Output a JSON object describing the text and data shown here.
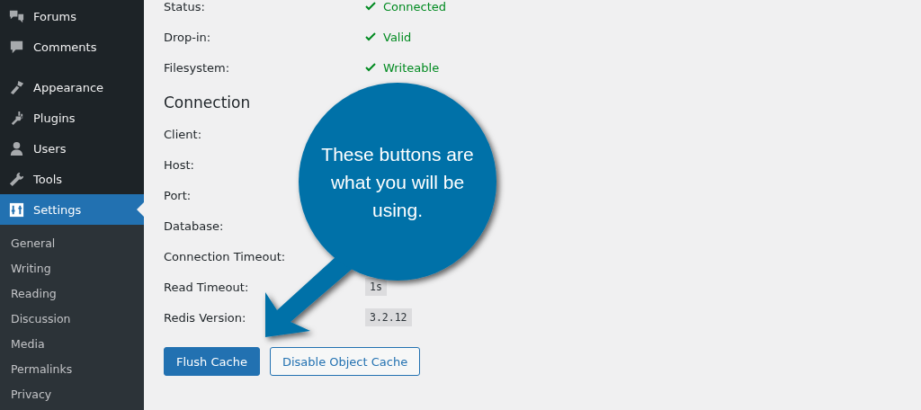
{
  "sidebar": {
    "items": [
      {
        "label": "Forums",
        "selected": false
      },
      {
        "label": "Comments",
        "selected": false
      },
      {
        "label": "Appearance",
        "selected": false
      },
      {
        "label": "Plugins",
        "selected": false
      },
      {
        "label": "Users",
        "selected": false
      },
      {
        "label": "Tools",
        "selected": false
      },
      {
        "label": "Settings",
        "selected": true
      }
    ],
    "submenu": [
      {
        "label": "General"
      },
      {
        "label": "Writing"
      },
      {
        "label": "Reading"
      },
      {
        "label": "Discussion"
      },
      {
        "label": "Media"
      },
      {
        "label": "Permalinks"
      },
      {
        "label": "Privacy"
      }
    ]
  },
  "status_rows": [
    {
      "label": "Status:",
      "kind": "status",
      "value": "Connected"
    },
    {
      "label": "Drop-in:",
      "kind": "status",
      "value": "Valid"
    },
    {
      "label": "Filesystem:",
      "kind": "status",
      "value": "Writeable"
    }
  ],
  "connection": {
    "heading": "Connection",
    "rows": [
      {
        "label": "Client:"
      },
      {
        "label": "Host:"
      },
      {
        "label": "Port:"
      },
      {
        "label": "Database:"
      },
      {
        "label": "Connection Timeout:"
      },
      {
        "label": "Read Timeout:",
        "kind": "code",
        "value": "1s"
      },
      {
        "label": "Redis Version:",
        "kind": "code",
        "value": "3.2.12"
      }
    ]
  },
  "buttons": [
    {
      "label": "Flush Cache",
      "kind": "primary"
    },
    {
      "label": "Disable Object Cache",
      "kind": "secondary"
    }
  ],
  "callout": {
    "text": "These buttons are what you will be using."
  }
}
